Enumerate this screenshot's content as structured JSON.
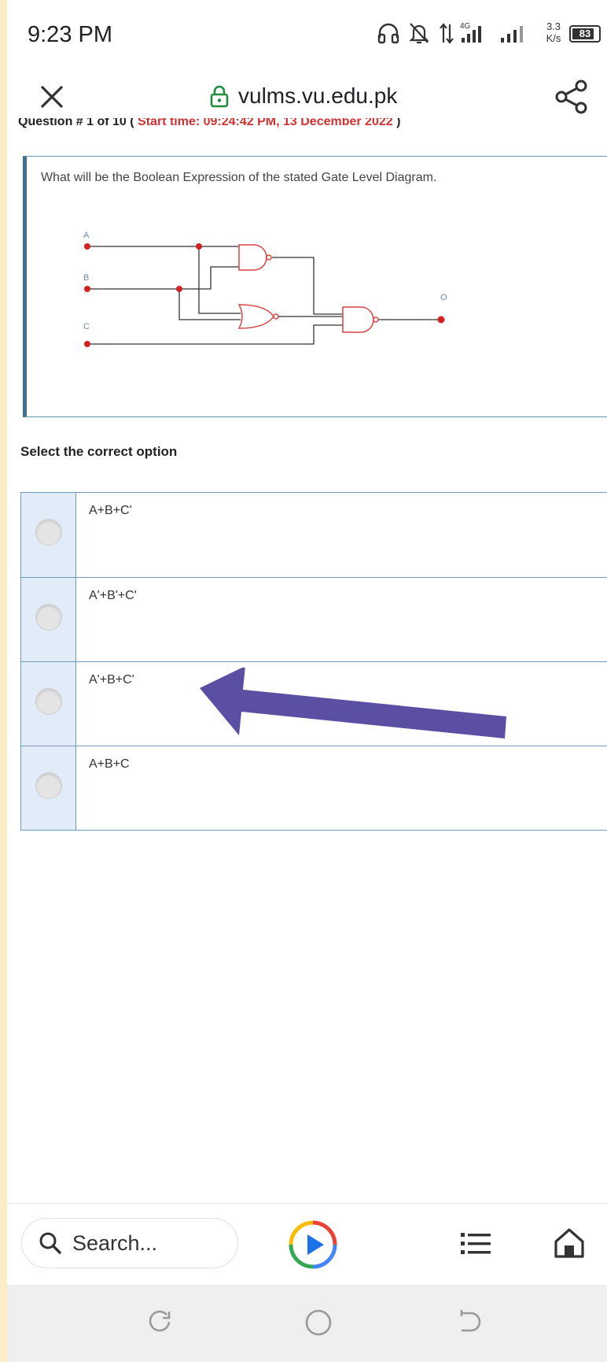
{
  "status_bar": {
    "time": "9:23 PM",
    "net_speed_value": "3.3",
    "net_speed_unit": "K/s",
    "network_type": "4G",
    "battery": "83",
    "battery_level_fraction": 0.83
  },
  "browser": {
    "url": "vulms.vu.edu.pk",
    "icons": {
      "close": "close-icon",
      "lock": "lock-icon",
      "share": "share-icon"
    }
  },
  "quiz": {
    "question_header_prefix": "Question # 1 of 10 (",
    "question_header_time": " Start time: 09:24:42 PM, 13 December 2022 ",
    "question_header_suffix": ")",
    "question_text": "What will be the Boolean Expression of the stated Gate Level Diagram.",
    "diagram": {
      "inputs": [
        "A",
        "B",
        "C"
      ],
      "output": "O",
      "gates": [
        "AND",
        "OR",
        "AND"
      ]
    },
    "select_label": "Select the correct option",
    "options": [
      {
        "label": "A+B+C'",
        "selected": false
      },
      {
        "label": "A'+B'+C'",
        "selected": false
      },
      {
        "label": "A'+B+C'",
        "selected": false
      },
      {
        "label": "A+B+C",
        "selected": false
      }
    ],
    "annotation_arrow_color": "#5b4fa3"
  },
  "toolbar": {
    "search_placeholder": "Search...",
    "icons": [
      "search-icon",
      "play-icon",
      "list-icon",
      "home-icon"
    ]
  },
  "navbar": {
    "icons": [
      "recent-apps-icon",
      "home-circle-icon",
      "back-icon"
    ]
  },
  "colors": {
    "background": "#fdecc8",
    "accent_red": "#d03232",
    "border_blue": "#6d9cbf",
    "radio_cell": "#e1ecf8",
    "lock_green": "#1e8e3e"
  }
}
